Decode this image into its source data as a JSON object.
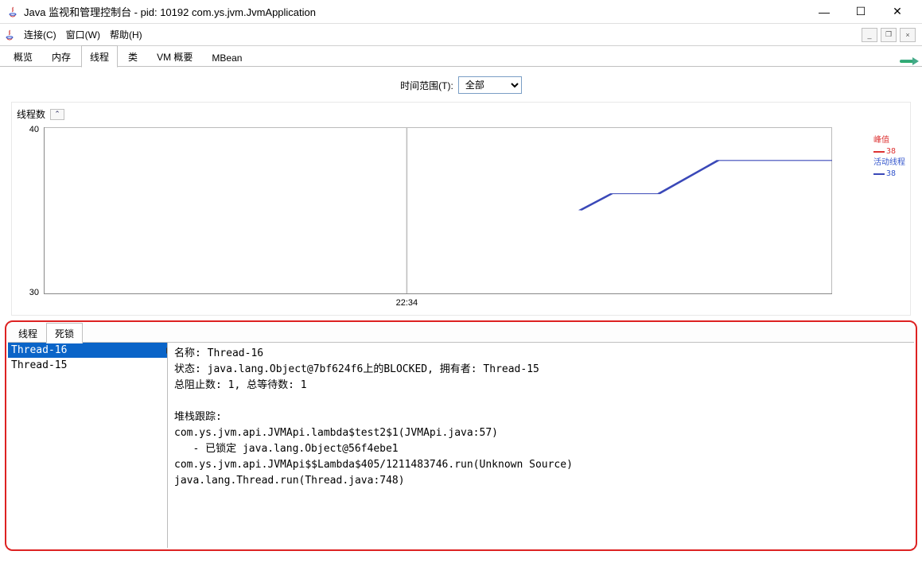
{
  "window": {
    "title": "Java 监视和管理控制台 - pid: 10192 com.ys.jvm.JvmApplication",
    "minimize": "—",
    "maximize": "☐",
    "close": "✕"
  },
  "menu": {
    "connect": "连接(C)",
    "window": "窗口(W)",
    "help": "帮助(H)"
  },
  "mini_controls": {
    "min": "_",
    "max": "❐",
    "close": "×"
  },
  "tabs": {
    "items": [
      "概览",
      "内存",
      "线程",
      "类",
      "VM 概要",
      "MBean"
    ],
    "active_index": 2
  },
  "time_range": {
    "label": "时间范围(T):",
    "value": "全部"
  },
  "chart": {
    "title": "线程数",
    "collapse_glyph": "⌃",
    "y_max": "40",
    "y_min": "30",
    "x_center": "22:34",
    "legend": {
      "peak_label": "峰值",
      "peak_value": "38",
      "live_label": "活动线程",
      "live_value": "38"
    }
  },
  "chart_data": {
    "type": "line",
    "ylabel": "线程数",
    "ylim": [
      30,
      40
    ],
    "x_ticks": [
      "22:34"
    ],
    "series": [
      {
        "name": "活动线程",
        "color": "#3a48b8",
        "points": [
          [
            0.68,
            0.5
          ],
          [
            0.72,
            0.6
          ],
          [
            0.78,
            0.6
          ],
          [
            0.855,
            0.8
          ],
          [
            0.95,
            0.8
          ],
          [
            1.0,
            0.8
          ]
        ]
      }
    ],
    "peak": 38,
    "live": 38
  },
  "bottom_tabs": {
    "items": [
      "线程",
      "死锁"
    ],
    "active_index": 1
  },
  "deadlock": {
    "threads": [
      "Thread-16",
      "Thread-15"
    ],
    "selected_index": 0,
    "detail": "名称: Thread-16\n状态: java.lang.Object@7bf624f6上的BLOCKED, 拥有者: Thread-15\n总阻止数: 1, 总等待数: 1\n\n堆栈跟踪: \ncom.ys.jvm.api.JVMApi.lambda$test2$1(JVMApi.java:57)\n   - 已锁定 java.lang.Object@56f4ebe1\ncom.ys.jvm.api.JVMApi$$Lambda$405/1211483746.run(Unknown Source)\njava.lang.Thread.run(Thread.java:748)"
  }
}
